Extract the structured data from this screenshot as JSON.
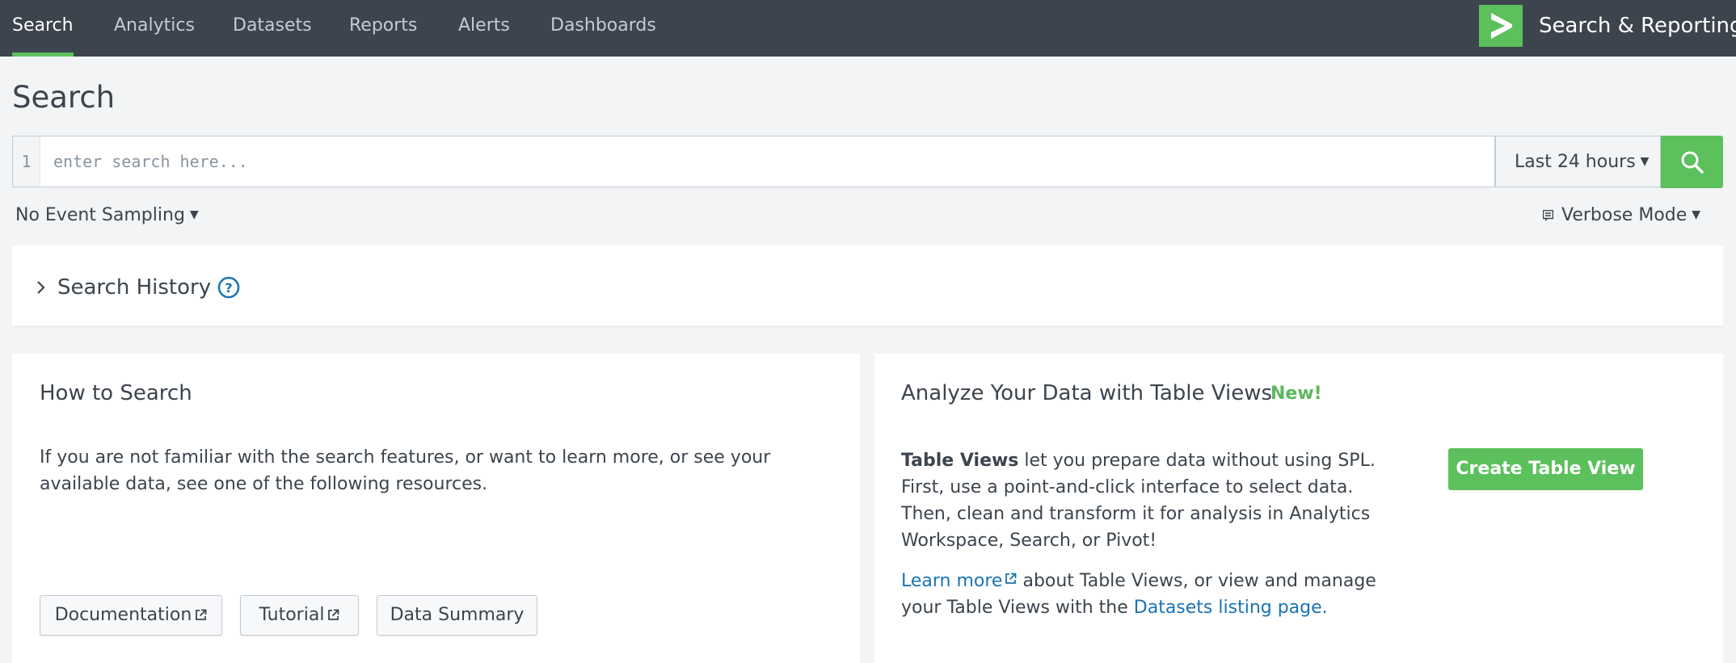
{
  "nav": {
    "items": [
      {
        "label": "Search",
        "active": true
      },
      {
        "label": "Analytics"
      },
      {
        "label": "Datasets"
      },
      {
        "label": "Reports"
      },
      {
        "label": "Alerts"
      },
      {
        "label": "Dashboards"
      }
    ],
    "app_title": "Search & Reporting",
    "logo_icon": "splunk-chevron-icon"
  },
  "page": {
    "title": "Search"
  },
  "search": {
    "line_number": "1",
    "placeholder": "enter search here...",
    "value": "",
    "time_range": "Last 24 hours",
    "submit_icon": "search-icon"
  },
  "options": {
    "sampling": "No Event Sampling",
    "mode": "Verbose Mode"
  },
  "history": {
    "title": "Search History",
    "help_icon": "question-circle-icon"
  },
  "how_to": {
    "title": "How to Search",
    "text": "If you are not familiar with the search features, or want to learn more, or see your available data, see one of the following resources.",
    "buttons": [
      {
        "label": "Documentation",
        "external": true
      },
      {
        "label": "Tutorial",
        "external": true
      },
      {
        "label": "Data Summary",
        "external": false
      }
    ]
  },
  "table_views": {
    "title": "Analyze Your Data with Table Views",
    "badge": "New!",
    "intro_bold": "Table Views",
    "intro_rest": " let you prepare data without using SPL. First, use a point-and-click interface to select data. Then, clean and transform it for analysis in Analytics Workspace, Search, or Pivot!",
    "learn_more": "Learn more",
    "learn_more_rest": " about Table Views, or view and manage your Table Views with the ",
    "datasets_link": "Datasets listing page.",
    "create_button": "Create Table View"
  },
  "colors": {
    "nav_bg": "#3c444d",
    "accent_green": "#5cc05c",
    "link_blue": "#1a73b3",
    "page_bg": "#f2f4f5"
  }
}
